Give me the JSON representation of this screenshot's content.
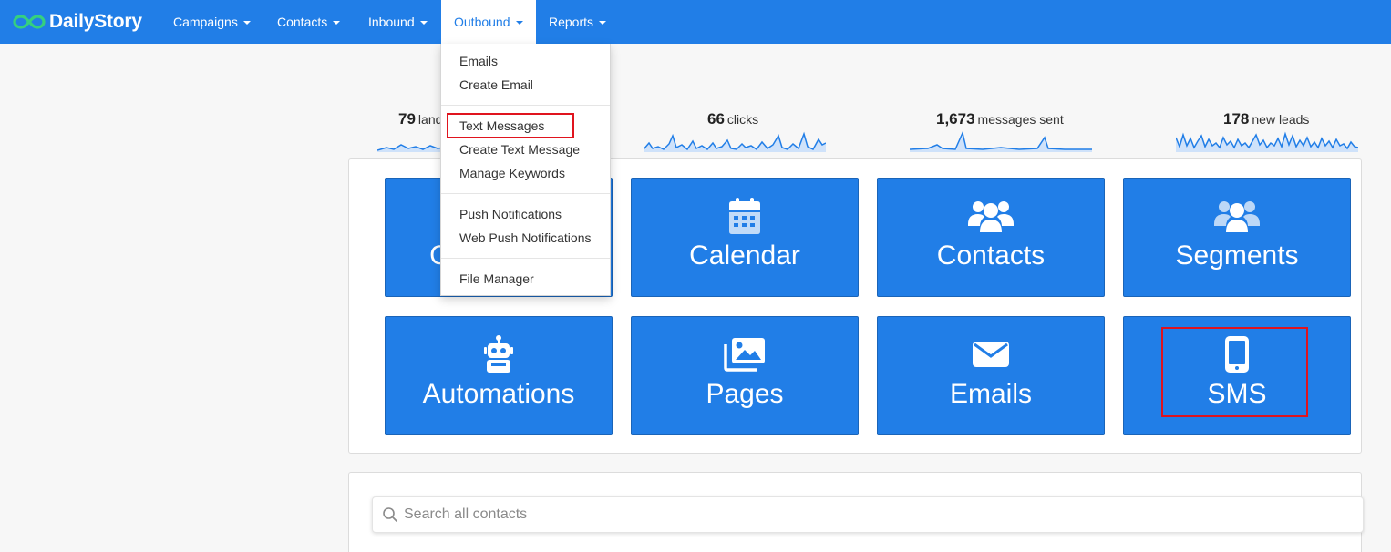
{
  "brand": {
    "name": "DailyStory",
    "logo_icon": "infinity-logo-icon",
    "logo_color": "#35d07f"
  },
  "colors": {
    "primary": "#217ee7",
    "highlight": "#e0141e"
  },
  "nav": {
    "items": [
      {
        "label": "Campaigns"
      },
      {
        "label": "Contacts"
      },
      {
        "label": "Inbound"
      },
      {
        "label": "Outbound"
      },
      {
        "label": "Reports"
      }
    ]
  },
  "dropdown": {
    "items": [
      {
        "label": "Emails"
      },
      {
        "label": "Create Email"
      },
      {
        "label": "Text Messages"
      },
      {
        "label": "Create Text Message"
      },
      {
        "label": "Manage Keywords"
      },
      {
        "label": "Push Notifications"
      },
      {
        "label": "Web Push Notifications"
      },
      {
        "label": "File Manager"
      }
    ]
  },
  "stats": [
    {
      "value": "79",
      "label": "landing page views"
    },
    {
      "value": "66",
      "label": "clicks"
    },
    {
      "value": "1,673",
      "label": "messages sent"
    },
    {
      "value": "178",
      "label": "new leads"
    }
  ],
  "tiles": [
    {
      "label": "Campaigns",
      "icon": "campaigns-icon"
    },
    {
      "label": "Calendar",
      "icon": "calendar-icon"
    },
    {
      "label": "Contacts",
      "icon": "users-icon"
    },
    {
      "label": "Segments",
      "icon": "user-group-icon"
    },
    {
      "label": "Automations",
      "icon": "robot-icon"
    },
    {
      "label": "Pages",
      "icon": "images-icon"
    },
    {
      "label": "Emails",
      "icon": "envelope-icon"
    },
    {
      "label": "SMS",
      "icon": "mobile-phone-icon"
    }
  ],
  "search": {
    "placeholder": "Search all contacts",
    "icon": "search-icon"
  }
}
